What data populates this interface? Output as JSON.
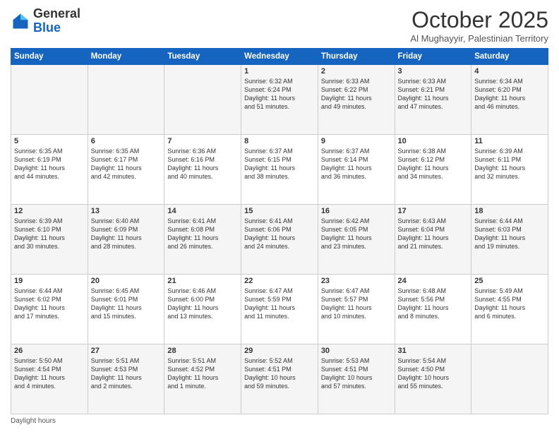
{
  "logo": {
    "general": "General",
    "blue": "Blue"
  },
  "header": {
    "month": "October 2025",
    "location": "Al Mughayyir, Palestinian Territory"
  },
  "days_of_week": [
    "Sunday",
    "Monday",
    "Tuesday",
    "Wednesday",
    "Thursday",
    "Friday",
    "Saturday"
  ],
  "footer": {
    "label": "Daylight hours"
  },
  "weeks": [
    [
      {
        "day": "",
        "info": ""
      },
      {
        "day": "",
        "info": ""
      },
      {
        "day": "",
        "info": ""
      },
      {
        "day": "1",
        "info": "Sunrise: 6:32 AM\nSunset: 6:24 PM\nDaylight: 11 hours\nand 51 minutes."
      },
      {
        "day": "2",
        "info": "Sunrise: 6:33 AM\nSunset: 6:22 PM\nDaylight: 11 hours\nand 49 minutes."
      },
      {
        "day": "3",
        "info": "Sunrise: 6:33 AM\nSunset: 6:21 PM\nDaylight: 11 hours\nand 47 minutes."
      },
      {
        "day": "4",
        "info": "Sunrise: 6:34 AM\nSunset: 6:20 PM\nDaylight: 11 hours\nand 46 minutes."
      }
    ],
    [
      {
        "day": "5",
        "info": "Sunrise: 6:35 AM\nSunset: 6:19 PM\nDaylight: 11 hours\nand 44 minutes."
      },
      {
        "day": "6",
        "info": "Sunrise: 6:35 AM\nSunset: 6:17 PM\nDaylight: 11 hours\nand 42 minutes."
      },
      {
        "day": "7",
        "info": "Sunrise: 6:36 AM\nSunset: 6:16 PM\nDaylight: 11 hours\nand 40 minutes."
      },
      {
        "day": "8",
        "info": "Sunrise: 6:37 AM\nSunset: 6:15 PM\nDaylight: 11 hours\nand 38 minutes."
      },
      {
        "day": "9",
        "info": "Sunrise: 6:37 AM\nSunset: 6:14 PM\nDaylight: 11 hours\nand 36 minutes."
      },
      {
        "day": "10",
        "info": "Sunrise: 6:38 AM\nSunset: 6:12 PM\nDaylight: 11 hours\nand 34 minutes."
      },
      {
        "day": "11",
        "info": "Sunrise: 6:39 AM\nSunset: 6:11 PM\nDaylight: 11 hours\nand 32 minutes."
      }
    ],
    [
      {
        "day": "12",
        "info": "Sunrise: 6:39 AM\nSunset: 6:10 PM\nDaylight: 11 hours\nand 30 minutes."
      },
      {
        "day": "13",
        "info": "Sunrise: 6:40 AM\nSunset: 6:09 PM\nDaylight: 11 hours\nand 28 minutes."
      },
      {
        "day": "14",
        "info": "Sunrise: 6:41 AM\nSunset: 6:08 PM\nDaylight: 11 hours\nand 26 minutes."
      },
      {
        "day": "15",
        "info": "Sunrise: 6:41 AM\nSunset: 6:06 PM\nDaylight: 11 hours\nand 24 minutes."
      },
      {
        "day": "16",
        "info": "Sunrise: 6:42 AM\nSunset: 6:05 PM\nDaylight: 11 hours\nand 23 minutes."
      },
      {
        "day": "17",
        "info": "Sunrise: 6:43 AM\nSunset: 6:04 PM\nDaylight: 11 hours\nand 21 minutes."
      },
      {
        "day": "18",
        "info": "Sunrise: 6:44 AM\nSunset: 6:03 PM\nDaylight: 11 hours\nand 19 minutes."
      }
    ],
    [
      {
        "day": "19",
        "info": "Sunrise: 6:44 AM\nSunset: 6:02 PM\nDaylight: 11 hours\nand 17 minutes."
      },
      {
        "day": "20",
        "info": "Sunrise: 6:45 AM\nSunset: 6:01 PM\nDaylight: 11 hours\nand 15 minutes."
      },
      {
        "day": "21",
        "info": "Sunrise: 6:46 AM\nSunset: 6:00 PM\nDaylight: 11 hours\nand 13 minutes."
      },
      {
        "day": "22",
        "info": "Sunrise: 6:47 AM\nSunset: 5:59 PM\nDaylight: 11 hours\nand 11 minutes."
      },
      {
        "day": "23",
        "info": "Sunrise: 6:47 AM\nSunset: 5:57 PM\nDaylight: 11 hours\nand 10 minutes."
      },
      {
        "day": "24",
        "info": "Sunrise: 6:48 AM\nSunset: 5:56 PM\nDaylight: 11 hours\nand 8 minutes."
      },
      {
        "day": "25",
        "info": "Sunrise: 5:49 AM\nSunset: 4:55 PM\nDaylight: 11 hours\nand 6 minutes."
      }
    ],
    [
      {
        "day": "26",
        "info": "Sunrise: 5:50 AM\nSunset: 4:54 PM\nDaylight: 11 hours\nand 4 minutes."
      },
      {
        "day": "27",
        "info": "Sunrise: 5:51 AM\nSunset: 4:53 PM\nDaylight: 11 hours\nand 2 minutes."
      },
      {
        "day": "28",
        "info": "Sunrise: 5:51 AM\nSunset: 4:52 PM\nDaylight: 11 hours\nand 1 minute."
      },
      {
        "day": "29",
        "info": "Sunrise: 5:52 AM\nSunset: 4:51 PM\nDaylight: 10 hours\nand 59 minutes."
      },
      {
        "day": "30",
        "info": "Sunrise: 5:53 AM\nSunset: 4:51 PM\nDaylight: 10 hours\nand 57 minutes."
      },
      {
        "day": "31",
        "info": "Sunrise: 5:54 AM\nSunset: 4:50 PM\nDaylight: 10 hours\nand 55 minutes."
      },
      {
        "day": "",
        "info": ""
      }
    ]
  ]
}
